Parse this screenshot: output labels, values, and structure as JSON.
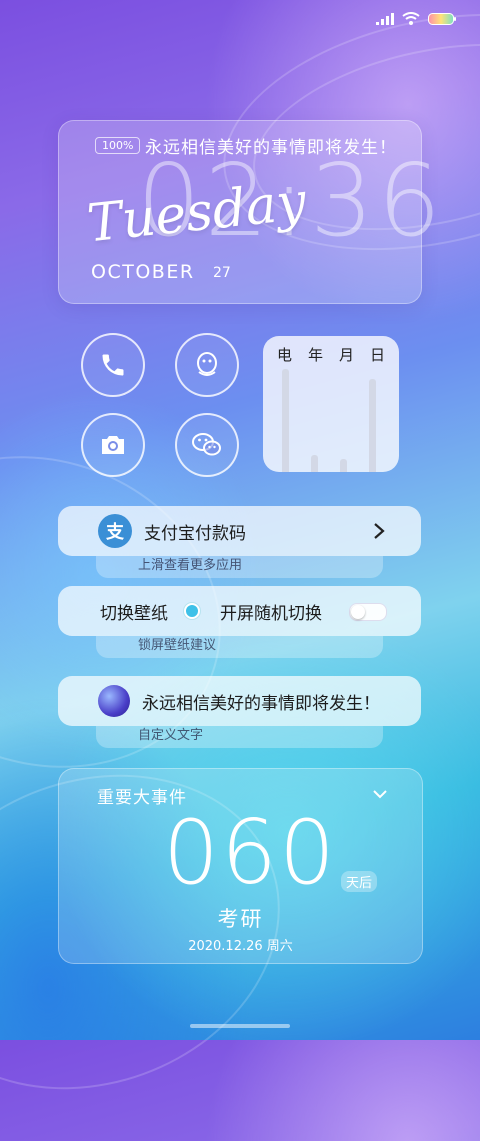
{
  "status_bar": {
    "icons": [
      "signal-icon",
      "wifi-icon",
      "battery-icon"
    ]
  },
  "clock": {
    "battery_badge": "100%",
    "motto": "永远相信美好的事情即将发生！",
    "time": "02:36",
    "weekday": "Tuesday",
    "month": "OCTOBER",
    "day": "27"
  },
  "shortcuts": [
    {
      "icon": "phone-icon"
    },
    {
      "icon": "qq-icon"
    },
    {
      "icon": "camera-icon"
    },
    {
      "icon": "wechat-icon"
    }
  ],
  "calendar_widget": {
    "headers": [
      "电",
      "年",
      "月",
      "日"
    ]
  },
  "alipay": {
    "label": "支付宝付款码",
    "hint": "上滑查看更多应用",
    "icon": "alipay-icon"
  },
  "wallpaper": {
    "switch_label": "切换壁纸",
    "random_label": "开屏随机切换",
    "random_on": false,
    "hint": "锁屏壁纸建议"
  },
  "custom_text": {
    "text": "永远相信美好的事情即将发生！",
    "hint": "自定义文字"
  },
  "event": {
    "title": "重要大事件",
    "days": "060",
    "unit": "天后",
    "name": "考研",
    "date": "2020.12.26  周六"
  },
  "colors": {
    "accent": "#3a8fd6",
    "toggle_dot": "#3ec1e8"
  }
}
